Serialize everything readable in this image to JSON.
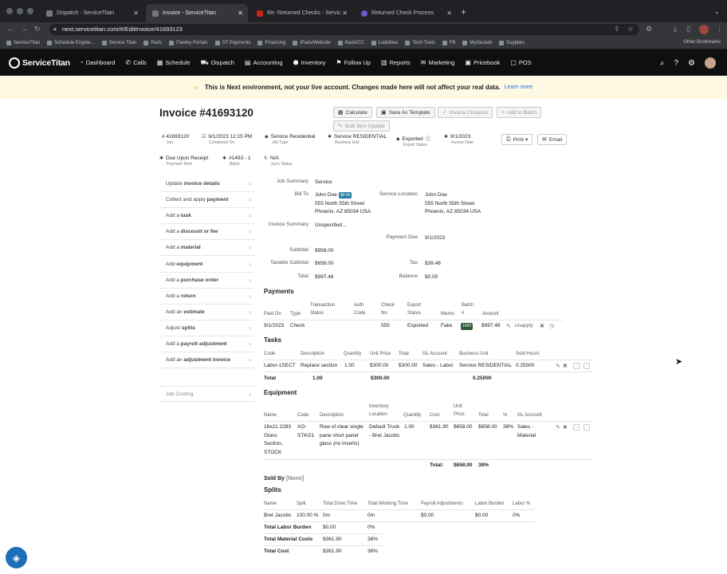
{
  "browser": {
    "tabs": [
      {
        "label": "Dispatch - ServiceTitan",
        "active": false
      },
      {
        "label": "Invoice - ServiceTitan",
        "active": true
      },
      {
        "label": "Re: Returned Checks - Servic",
        "active": false
      },
      {
        "label": "Returned Check Process",
        "active": false
      }
    ],
    "url": "next.servicetitan.com/#/EditInvoice/41693123",
    "bookmarks": [
      "ServiceTitan",
      "Schedule Engine...",
      "Service Titan",
      "Parts",
      "Fawley Portals",
      "ST Payments",
      "Financing",
      "iPads/Website",
      "Bank/CC",
      "Liabilities",
      "Tech Tools",
      "FB",
      "MyGeotab",
      "Supplies"
    ],
    "other_bookmarks": "Other Bookmarks"
  },
  "app": {
    "logo": "ServiceTitan",
    "nav": [
      {
        "label": "Dashboard",
        "icon": "◔"
      },
      {
        "label": "Calls",
        "icon": "✆"
      },
      {
        "label": "Schedule",
        "icon": "▦"
      },
      {
        "label": "Dispatch",
        "icon": "⛟"
      },
      {
        "label": "Accounting",
        "icon": "▤"
      },
      {
        "label": "Inventory",
        "icon": "⬢"
      },
      {
        "label": "Follow Up",
        "icon": "⚑"
      },
      {
        "label": "Reports",
        "icon": "▥"
      },
      {
        "label": "Marketing",
        "icon": "✉"
      },
      {
        "label": "Pricebook",
        "icon": "▣"
      },
      {
        "label": "POS",
        "icon": "▢"
      }
    ]
  },
  "banner": {
    "text": "This is Next environment, not your live account. Changes made here will not affect your real data.",
    "link": "Learn more"
  },
  "invoice": {
    "title": "Invoice #41693120",
    "actions": {
      "calculate": "Calculate",
      "save_template": "Save As Template",
      "invoice_closeout": "Invoice Closeout",
      "add_batch": "Add to Batch",
      "bulk_update": "Bulk Item Update",
      "print": "Print",
      "email": "Email"
    },
    "meta": {
      "job": {
        "value": "# 41693120",
        "label": "Job"
      },
      "completed": {
        "value": "9/1/2023 12:15 PM",
        "label": "Completed On"
      },
      "job_type": {
        "value": "Service Residential",
        "label": "Job Type"
      },
      "business_unit": {
        "value": "Service RESIDENTIAL",
        "label": "Business Unit"
      },
      "export": {
        "value": "Exported",
        "label": "Export Status"
      },
      "invoice_date": {
        "value": "9/1/2023",
        "label": "Invoice Date"
      },
      "payment_term": {
        "value": "Due Upon Receipt",
        "label": "Payment Term"
      },
      "batch": {
        "value": "#1493 - 1",
        "label": "Batch"
      },
      "sync": {
        "value": "N/A",
        "label": "Sync Status"
      }
    },
    "side_menu": [
      {
        "pre": "Update ",
        "strong": "invoice details"
      },
      {
        "pre": "Collect and apply ",
        "strong": "payment"
      },
      {
        "pre": "Add a ",
        "strong": "task"
      },
      {
        "pre": "Add a ",
        "strong": "discount or fee"
      },
      {
        "pre": "Add a ",
        "strong": "material"
      },
      {
        "pre": "Add ",
        "strong": "equipment"
      },
      {
        "pre": "Add a ",
        "strong": "purchase order"
      },
      {
        "pre": "Add a ",
        "strong": "return"
      },
      {
        "pre": "Add an ",
        "strong": "estimate"
      },
      {
        "pre": "Adjust ",
        "strong": "splits"
      },
      {
        "pre": "Add a ",
        "strong": "payroll adjustment"
      },
      {
        "pre": "Add an ",
        "strong": "adjustment invoice"
      }
    ],
    "job_costing": "Job Costing",
    "summary": {
      "job_summary_label": "Job Summary",
      "job_summary": "Service",
      "bill_to_label": "Bill To",
      "bill_name": "John Doe",
      "bill_chip": "$0.00",
      "bill_street": "555 North 55th Street",
      "bill_city": "Phoenix, AZ 85034 USA",
      "service_location_label": "Service Location",
      "loc_name": "John Doe",
      "loc_street": "555 North 55th Street",
      "loc_city": "Phoenix, AZ 85034 USA",
      "invoice_summary_label": "Invoice Summary",
      "invoice_summary": "Unspecified ..",
      "payment_due_label": "Payment Due",
      "payment_due": "9/1/2023",
      "subtotal_label": "Subtotal",
      "subtotal": "$958.00",
      "taxable_label": "Taxable Subtotal",
      "taxable": "$658.00",
      "tax_label": "Tax",
      "tax": "$39.48",
      "total_label": "Total",
      "total": "$997.48",
      "balance_label": "Balance",
      "balance": "$0.00"
    },
    "payments": {
      "title": "Payments",
      "headers": {
        "paid_on": "Paid On",
        "type": "Type",
        "transaction": "Transaction Status",
        "auth": "Auth Code",
        "check": "Check No",
        "export": "Export Status",
        "memo": "Memo",
        "batch": "Batch #",
        "amount": "Amount"
      },
      "row": {
        "paid_on": "9/1/2023",
        "type": "Check",
        "check": "555",
        "export": "Exported",
        "memo": "Fake",
        "batch": "1493",
        "amount": "$997.48",
        "unapply": "unapply"
      }
    },
    "tasks": {
      "title": "Tasks",
      "headers": {
        "code": "Code",
        "description": "Description",
        "quantity": "Quantity",
        "unit_price": "Unit Price",
        "total": "Total",
        "gl": "GL Account",
        "bu": "Business Unit",
        "hours": "Sold Hours"
      },
      "row": {
        "code": "Labor-1SECT",
        "description": "Replace section",
        "quantity": "1.00",
        "unit_price": "$300.00",
        "total": "$300.00",
        "gl": "Sales - Labor",
        "bu": "Service RESIDENTIAL",
        "hours": "0.25000"
      },
      "totals": {
        "label": "Total",
        "quantity": "1.00",
        "unit_price": "$300.00",
        "hours": "0.25000"
      }
    },
    "equipment": {
      "title": "Equipment",
      "headers": {
        "name": "Name",
        "code": "Code",
        "description": "Description",
        "inventory": "Inventory Location",
        "quantity": "Quantity",
        "cost": "Cost",
        "unit_price": "Unit Price",
        "total": "Total",
        "pct": "%",
        "gl": "GL Account"
      },
      "row": {
        "name": "16x21 2283 Glass Section, STOCK",
        "code": "XO-STKG1",
        "description": "Row of clear single pane short panel glass (no inserts)",
        "inventory": "Default Truck - Bret Jacobs",
        "quantity": "1.00",
        "cost": "$361.90",
        "unit_price": "$658.00",
        "total": "$658.00",
        "pct": "38%",
        "gl": "Sales - Material"
      },
      "totals": {
        "label": "Total:",
        "total": "$658.00",
        "pct": "38%"
      }
    },
    "sold_by": {
      "label": "Sold By",
      "value": "[None]"
    },
    "splits": {
      "title": "Splits",
      "headers": {
        "name": "Name",
        "split": "Split",
        "drive": "Total Drive Time",
        "working": "Total Working Time",
        "payroll": "Payroll Adjustments",
        "burden": "Labor Burden",
        "labor_pct": "Labor %"
      },
      "row": {
        "name": "Bret Jacobs",
        "split": "100.00 %",
        "drive": "0m",
        "working": "0m",
        "payroll": "$0.00",
        "burden": "$0.00",
        "labor_pct": "0%"
      },
      "summary": [
        {
          "label": "Total Labor Burden",
          "value": "$0.00",
          "pct": "0%"
        },
        {
          "label": "Total Material Costs",
          "value": "$361.90",
          "pct": "38%"
        },
        {
          "label": "Total Cost",
          "value": "$361.90",
          "pct": "38%"
        }
      ]
    }
  }
}
